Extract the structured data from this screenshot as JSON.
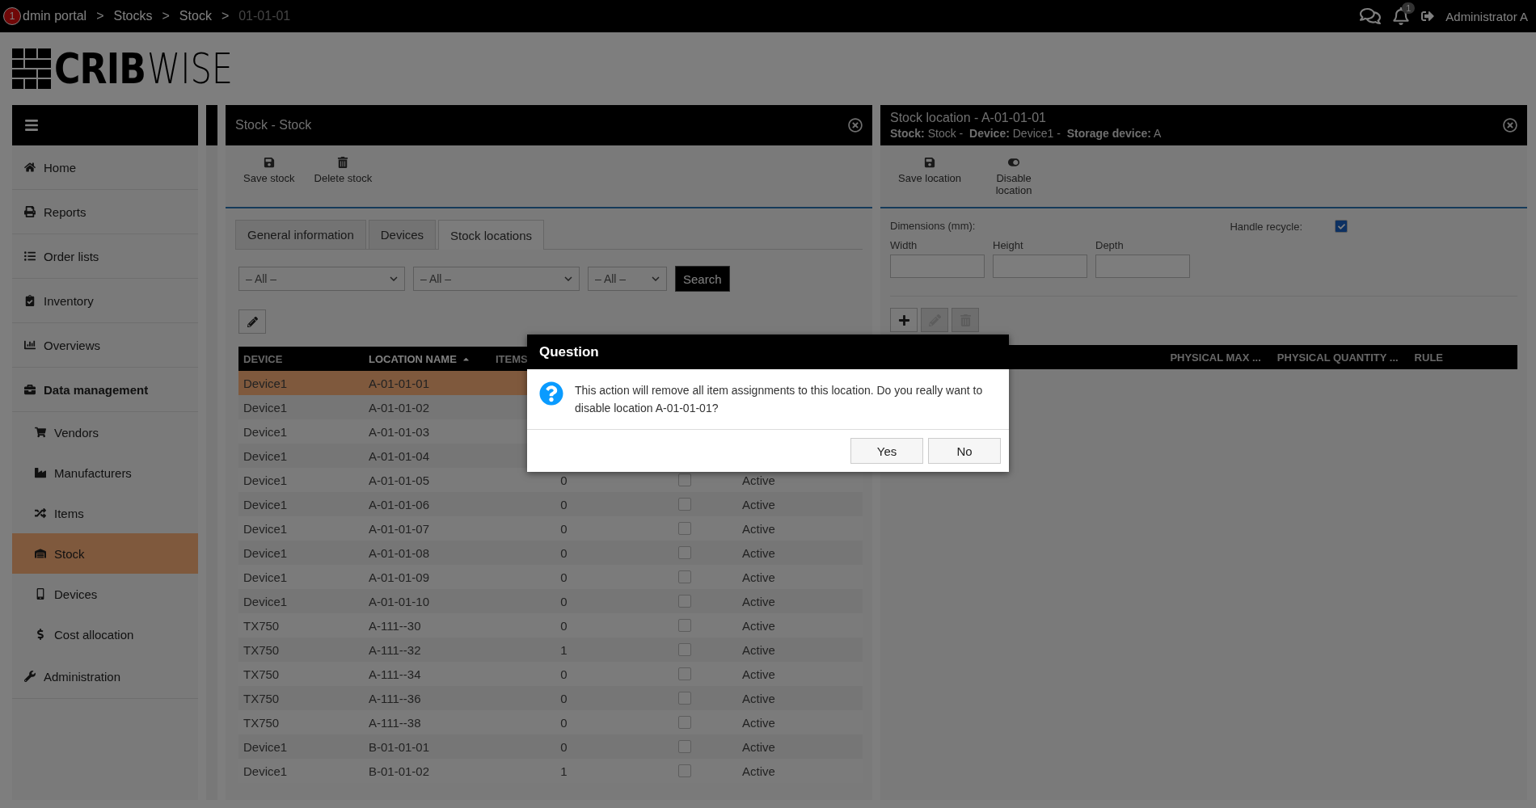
{
  "top_bar": {
    "badge": "1",
    "breadcrumb": [
      {
        "label": "dmin portal",
        "separator": ">",
        "current": false
      },
      {
        "label": "Stocks",
        "separator": ">",
        "current": false
      },
      {
        "label": "Stock",
        "separator": ">",
        "current": false
      },
      {
        "label": "01-01-01",
        "current": true
      }
    ],
    "notification_count": "1",
    "user": "Administrator A"
  },
  "logo": {
    "bold": "CRIB",
    "light": "WISE"
  },
  "sidebar": {
    "items": [
      {
        "label": "Home",
        "kind": "home",
        "selected": false
      },
      {
        "label": "Reports",
        "kind": "print",
        "selected": false
      },
      {
        "label": "Order lists",
        "kind": "list",
        "selected": false
      },
      {
        "label": "Inventory",
        "kind": "clipboard",
        "selected": false
      },
      {
        "label": "Overviews",
        "kind": "chart",
        "selected": false
      },
      {
        "label": "Data management",
        "kind": "briefcase",
        "selected": false,
        "expanded": true,
        "children": [
          {
            "label": "Vendors",
            "kind": "cart",
            "selected": false
          },
          {
            "label": "Manufacturers",
            "kind": "factory",
            "selected": false
          },
          {
            "label": "Items",
            "kind": "shuffle",
            "selected": false
          },
          {
            "label": "Stock",
            "kind": "warehouse",
            "selected": true
          },
          {
            "label": "Devices",
            "kind": "mobile",
            "selected": false
          },
          {
            "label": "Cost allocation",
            "kind": "dollar",
            "selected": false
          }
        ]
      },
      {
        "label": "Administration",
        "kind": "wrench",
        "selected": false
      }
    ]
  },
  "stock_panel": {
    "title": "Stock - Stock",
    "toolbar": [
      {
        "label": "Save stock",
        "kind": "save"
      },
      {
        "label": "Delete stock",
        "kind": "trash"
      }
    ],
    "tabs": [
      {
        "label": "General information",
        "selected": false
      },
      {
        "label": "Devices",
        "selected": false
      },
      {
        "label": "Stock locations",
        "selected": true
      }
    ],
    "filters": [
      "– All –",
      "– All –",
      "– All –"
    ],
    "search_button": "Search",
    "table": {
      "columns": [
        {
          "label": "DEVICE",
          "sorted": false
        },
        {
          "label": "LOCATION NAME",
          "sorted": true
        },
        {
          "label": "ITEMS",
          "sorted": false
        }
      ],
      "rows": [
        {
          "device": "Device1",
          "location": "A-01-01-01",
          "selected": true
        },
        {
          "device": "Device1",
          "location": "A-01-01-02",
          "selected": false
        },
        {
          "device": "Device1",
          "location": "A-01-01-03",
          "selected": false
        },
        {
          "device": "Device1",
          "location": "A-01-01-04",
          "selected": false
        },
        {
          "device": "Device1",
          "location": "A-01-01-05",
          "items": "0",
          "checked": false,
          "status": "Active",
          "selected": false
        },
        {
          "device": "Device1",
          "location": "A-01-01-06",
          "items": "0",
          "checked": false,
          "status": "Active",
          "selected": false
        },
        {
          "device": "Device1",
          "location": "A-01-01-07",
          "items": "0",
          "checked": false,
          "status": "Active",
          "selected": false
        },
        {
          "device": "Device1",
          "location": "A-01-01-08",
          "items": "0",
          "checked": false,
          "status": "Active",
          "selected": false
        },
        {
          "device": "Device1",
          "location": "A-01-01-09",
          "items": "0",
          "checked": false,
          "status": "Active",
          "selected": false
        },
        {
          "device": "Device1",
          "location": "A-01-01-10",
          "items": "0",
          "checked": false,
          "status": "Active",
          "selected": false
        },
        {
          "device": "TX750",
          "location": "A-111--30",
          "items": "0",
          "checked": false,
          "status": "Active",
          "selected": false
        },
        {
          "device": "TX750",
          "location": "A-111--32",
          "items": "1",
          "checked": false,
          "status": "Active",
          "selected": false
        },
        {
          "device": "TX750",
          "location": "A-111--34",
          "items": "0",
          "checked": false,
          "status": "Active",
          "selected": false
        },
        {
          "device": "TX750",
          "location": "A-111--36",
          "items": "0",
          "checked": false,
          "status": "Active",
          "selected": false
        },
        {
          "device": "TX750",
          "location": "A-111--38",
          "items": "0",
          "checked": false,
          "status": "Active",
          "selected": false
        },
        {
          "device": "Device1",
          "location": "B-01-01-01",
          "items": "0",
          "checked": false,
          "status": "Active",
          "selected": false
        },
        {
          "device": "Device1",
          "location": "B-01-01-02",
          "items": "1",
          "checked": false,
          "status": "Active",
          "selected": false
        }
      ]
    }
  },
  "location_panel": {
    "title": "Stock location - A-01-01-01",
    "meta": "**Stock:** Stock -  **Device:** Device1 -  **Storage device:** A",
    "toolbar": [
      {
        "label": "Save location",
        "kind": "save"
      },
      {
        "label": "Disable location",
        "kind": "toggle"
      }
    ],
    "dimensions_label": "Dimensions (mm):",
    "fields": [
      "Width",
      "Height",
      "Depth"
    ],
    "handle_recycle": {
      "label": "Handle recycle:",
      "checked": true
    },
    "actions": [
      {
        "kind": "plus",
        "disabled": false
      },
      {
        "kind": "pencil",
        "disabled": true
      },
      {
        "kind": "trash",
        "disabled": true
      }
    ],
    "columns": [
      "PHYSICAL MAX ...",
      "PHYSICAL QUANTITY ...",
      "RULE"
    ]
  },
  "dialog": {
    "title": "Question",
    "message": "This action will remove all item assignments to this location. Do you really want to disable location A-01-01-01?",
    "buttons": [
      "Yes",
      "No"
    ]
  }
}
